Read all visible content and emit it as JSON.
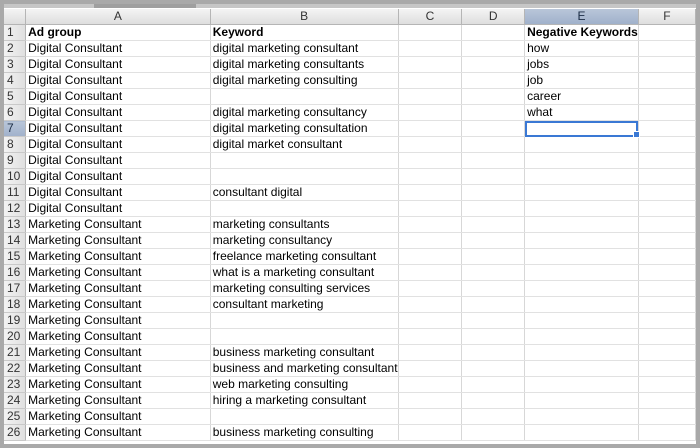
{
  "columns": [
    "A",
    "B",
    "C",
    "D",
    "E",
    "F"
  ],
  "selected_column": "E",
  "selected_row": 7,
  "active_cell": "E7",
  "colors": {
    "active_cell_border": "#3a78d4",
    "selected_header": "#a0b1cb"
  },
  "rows": [
    {
      "n": "1",
      "A": "Ad group",
      "B": "Keyword",
      "E": "Negative Keywords",
      "header": true
    },
    {
      "n": "2",
      "A": "Digital Consultant",
      "B": "digital marketing consultant",
      "E": "how"
    },
    {
      "n": "3",
      "A": "Digital Consultant",
      "B": "digital marketing consultants",
      "E": "jobs"
    },
    {
      "n": "4",
      "A": "Digital Consultant",
      "B": "digital marketing consulting",
      "E": "job"
    },
    {
      "n": "5",
      "A": "Digital Consultant",
      "B": "",
      "E": "career"
    },
    {
      "n": "6",
      "A": "Digital Consultant",
      "B": "digital marketing consultancy",
      "E": "what"
    },
    {
      "n": "7",
      "A": "Digital Consultant",
      "B": "digital marketing consultation",
      "E": ""
    },
    {
      "n": "8",
      "A": "Digital Consultant",
      "B": "digital market consultant",
      "E": ""
    },
    {
      "n": "9",
      "A": "Digital Consultant",
      "B": "",
      "E": ""
    },
    {
      "n": "10",
      "A": "Digital Consultant",
      "B": "",
      "E": ""
    },
    {
      "n": "11",
      "A": "Digital Consultant",
      "B": "consultant digital",
      "E": ""
    },
    {
      "n": "12",
      "A": "Digital Consultant",
      "B": "",
      "E": ""
    },
    {
      "n": "13",
      "A": "Marketing Consultant",
      "B": "marketing consultants",
      "E": ""
    },
    {
      "n": "14",
      "A": "Marketing Consultant",
      "B": "marketing consultancy",
      "E": ""
    },
    {
      "n": "15",
      "A": "Marketing Consultant",
      "B": "freelance marketing consultant",
      "E": ""
    },
    {
      "n": "16",
      "A": "Marketing Consultant",
      "B": "what is a marketing consultant",
      "E": ""
    },
    {
      "n": "17",
      "A": "Marketing Consultant",
      "B": "marketing consulting services",
      "E": ""
    },
    {
      "n": "18",
      "A": "Marketing Consultant",
      "B": "consultant marketing",
      "E": ""
    },
    {
      "n": "19",
      "A": "Marketing Consultant",
      "B": "",
      "E": ""
    },
    {
      "n": "20",
      "A": "Marketing Consultant",
      "B": "",
      "E": ""
    },
    {
      "n": "21",
      "A": "Marketing Consultant",
      "B": "business marketing consultant",
      "E": ""
    },
    {
      "n": "22",
      "A": "Marketing Consultant",
      "B": "business and marketing consultant",
      "E": ""
    },
    {
      "n": "23",
      "A": "Marketing Consultant",
      "B": "web marketing consulting",
      "E": ""
    },
    {
      "n": "24",
      "A": "Marketing Consultant",
      "B": "hiring a marketing consultant",
      "E": ""
    },
    {
      "n": "25",
      "A": "Marketing Consultant",
      "B": "",
      "E": ""
    },
    {
      "n": "26",
      "A": "Marketing Consultant",
      "B": "business marketing consulting",
      "E": ""
    }
  ]
}
